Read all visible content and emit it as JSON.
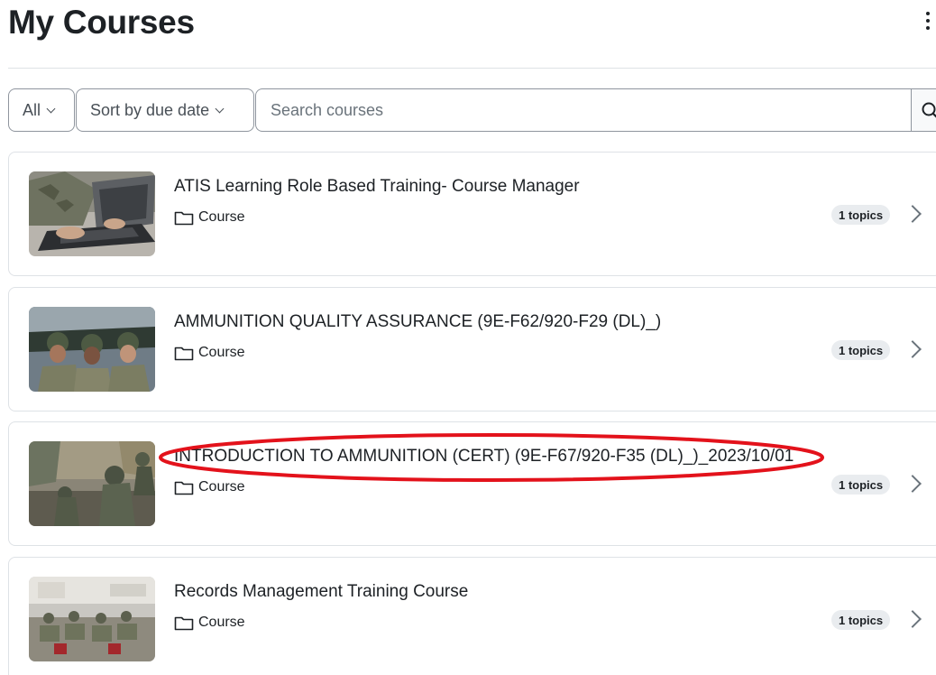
{
  "header": {
    "title": "My Courses"
  },
  "filters": {
    "grouping_label": "All",
    "sort_label": "Sort by due date",
    "search_placeholder": "Search courses"
  },
  "courses": [
    {
      "name": "ATIS Learning Role Based Training- Course Manager",
      "category": "Course",
      "topics_badge": "1 topics"
    },
    {
      "name": "AMMUNITION QUALITY ASSURANCE (9E-F62/920-F29 (DL)_)",
      "category": "Course",
      "topics_badge": "1 topics"
    },
    {
      "name": "INTRODUCTION TO AMMUNITION (CERT) (9E-F67/920-F35 (DL)_)_2023/10/01",
      "category": "Course",
      "topics_badge": "1 topics"
    },
    {
      "name": "Records Management Training Course",
      "category": "Course",
      "topics_badge": "1 topics"
    }
  ],
  "annotation": {
    "color": "#e3121b"
  }
}
